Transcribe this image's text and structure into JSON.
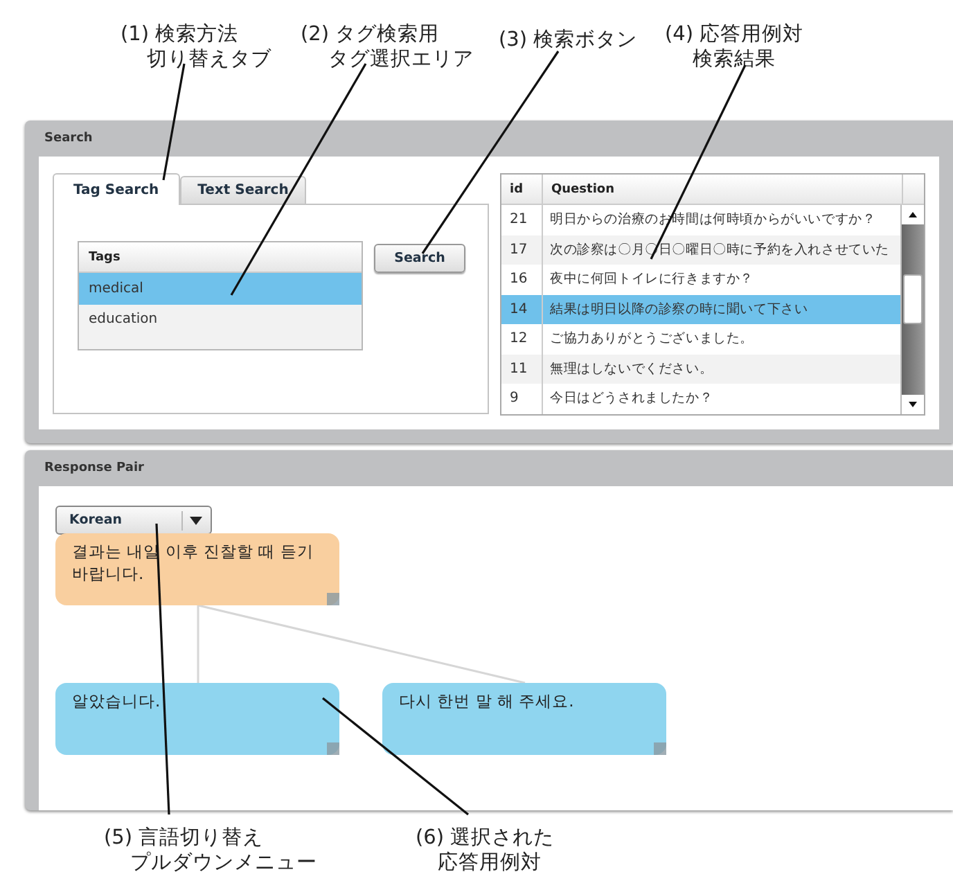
{
  "annotations": [
    {
      "lines": [
        "(1) 検索方法",
        "切り替えタブ"
      ]
    },
    {
      "lines": [
        "(2) タグ検索用",
        "タグ選択エリア"
      ]
    },
    {
      "lines": [
        "(3) 検索ボタン"
      ]
    },
    {
      "lines": [
        "(4) 応答用例対",
        "検索結果"
      ]
    },
    {
      "lines": [
        "(5) 言語切り替え",
        "プルダウンメニュー"
      ]
    },
    {
      "lines": [
        "(6) 選択された",
        "応答用例対"
      ]
    }
  ],
  "search_panel": {
    "title": "Search",
    "tabs": [
      {
        "label": "Tag Search",
        "selected": true
      },
      {
        "label": "Text Search",
        "selected": false
      }
    ],
    "tags_table": {
      "columns": [
        "Tags"
      ],
      "rows": [
        {
          "tag": "medical",
          "selected": true
        },
        {
          "tag": "education",
          "selected": false
        }
      ]
    },
    "search_button": "Search",
    "results_table": {
      "columns": [
        "id",
        "Question"
      ],
      "rows": [
        {
          "id": "21",
          "question": "明日からの治療のお時間は何時頃からがいいですか？",
          "selected": false
        },
        {
          "id": "17",
          "question": "次の診察は〇月〇日〇曜日〇時に予約を入れさせていた",
          "selected": false
        },
        {
          "id": "16",
          "question": "夜中に何回トイレに行きますか？",
          "selected": false
        },
        {
          "id": "14",
          "question": "結果は明日以降の診察の時に聞いて下さい",
          "selected": true
        },
        {
          "id": "12",
          "question": "ご協力ありがとうございました。",
          "selected": false
        },
        {
          "id": "11",
          "question": "無理はしないでください。",
          "selected": false
        },
        {
          "id": "9",
          "question": "今日はどうされましたか？",
          "selected": false
        }
      ]
    }
  },
  "response_panel": {
    "title": "Response Pair",
    "language_dropdown": {
      "value": "Korean"
    },
    "pair": {
      "text": "결과는 내일 이후 진찰할 때 듣기 바랍니다.",
      "color": "#f9cf9f",
      "children": [
        {
          "text": "알았습니다.",
          "color": "#8fd5ef"
        },
        {
          "text": "다시 한번 말 해 주세요.",
          "color": "#8fd5ef"
        }
      ]
    }
  }
}
